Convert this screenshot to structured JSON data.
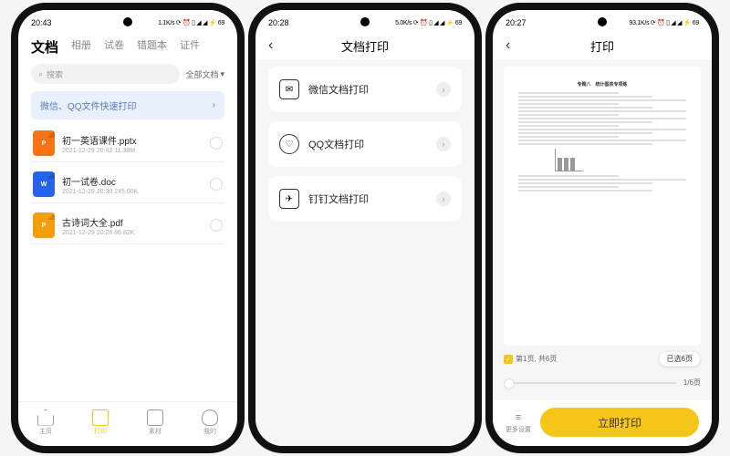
{
  "phone1": {
    "status": {
      "time": "20:43",
      "right": "1.1K/s ⟳ ⏰ ▯ ◢ ◢ ⚡ 69"
    },
    "tabs": [
      "文档",
      "相册",
      "试卷",
      "错题本",
      "证件"
    ],
    "search": {
      "placeholder": "搜索",
      "filter": "全部文档"
    },
    "banner": "微信、QQ文件快速打印",
    "files": [
      {
        "name": "初一英语课件.pptx",
        "meta": "2021-12-29 20:42 11.38M",
        "type": "ppt",
        "ext": "P"
      },
      {
        "name": "初一试卷.doc",
        "meta": "2021-12-29 20:30 245.00K",
        "type": "doc",
        "ext": "W"
      },
      {
        "name": "古诗词大全.pdf",
        "meta": "2021-12-29 20:26 86.82K",
        "type": "pdf",
        "ext": "P"
      }
    ],
    "nav": [
      {
        "label": "主页",
        "active": false
      },
      {
        "label": "打印",
        "active": true
      },
      {
        "label": "素材",
        "active": false
      },
      {
        "label": "我的",
        "active": false
      }
    ]
  },
  "phone2": {
    "status": {
      "time": "20:28",
      "right": "5.0K/s ⟳ ⏰ ▯ ◢ ◢ ⚡ 69"
    },
    "title": "文档打印",
    "options": [
      {
        "label": "微信文档打印",
        "icon": "wechat"
      },
      {
        "label": "QQ文档打印",
        "icon": "qq"
      },
      {
        "label": "钉钉文档打印",
        "icon": "dingtalk"
      }
    ]
  },
  "phone3": {
    "status": {
      "time": "20:27",
      "right": "93.1K/s ⟳ ⏰ ▯ ◢ ◢ ⚡ 69"
    },
    "title": "打印",
    "doc_title": "专题八　统计图表专项练",
    "page_label": "第1页, 共6页",
    "selected": "已选6页",
    "slider": "1/6页",
    "more": "更多设置",
    "print_btn": "立即打印"
  }
}
